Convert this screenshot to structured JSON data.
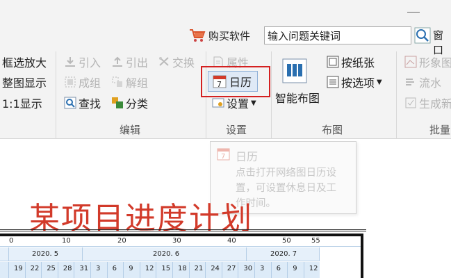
{
  "header": {
    "store_label": "购买软件",
    "search_value": "输入问题关键词",
    "window_label": "窗口"
  },
  "ribbon": {
    "view_tools": [
      "框选放大",
      "整图显示",
      "1:1显示"
    ],
    "edit_tools": {
      "import": "引入",
      "export": "引出",
      "swap": "交换",
      "group": "成组",
      "ungroup": "解组",
      "find": "查找",
      "classify": "分类"
    },
    "settings_tools": {
      "attributes": "属性",
      "calendar": "日历",
      "settings": "设置"
    },
    "layout_tools": {
      "smart_layout": "智能布图",
      "by_paper": "按纸张",
      "by_options": "按选项"
    },
    "batch_tools": [
      "形象图",
      "流水",
      "生成新"
    ],
    "group_labels": {
      "edit": "编辑",
      "settings": "设置",
      "layout": "布图",
      "batch": "批量"
    }
  },
  "tooltip": {
    "title": "日历",
    "lines": [
      "点击打开网络图日历设",
      "置，可设置休息日及工",
      "作时间。"
    ]
  },
  "project": {
    "title": "某项目进度计划"
  },
  "gantt": {
    "ruler_ticks": [
      "0",
      "10",
      "20",
      "30",
      "40",
      "50",
      "55"
    ],
    "months": [
      "2020. 5",
      "2020. 6",
      "2020. 7"
    ],
    "days": [
      "19",
      "22",
      "25",
      "28",
      "31",
      "3",
      "6",
      "9",
      "12",
      "15",
      "18",
      "21",
      "24",
      "27",
      "30",
      "3",
      "6",
      "9",
      "12"
    ]
  },
  "colors": {
    "accent_red": "#d42020",
    "title_red": "#d23a2a",
    "ribbon_bg": "#f3f3f3",
    "grid_blue": "#b4cde6"
  }
}
